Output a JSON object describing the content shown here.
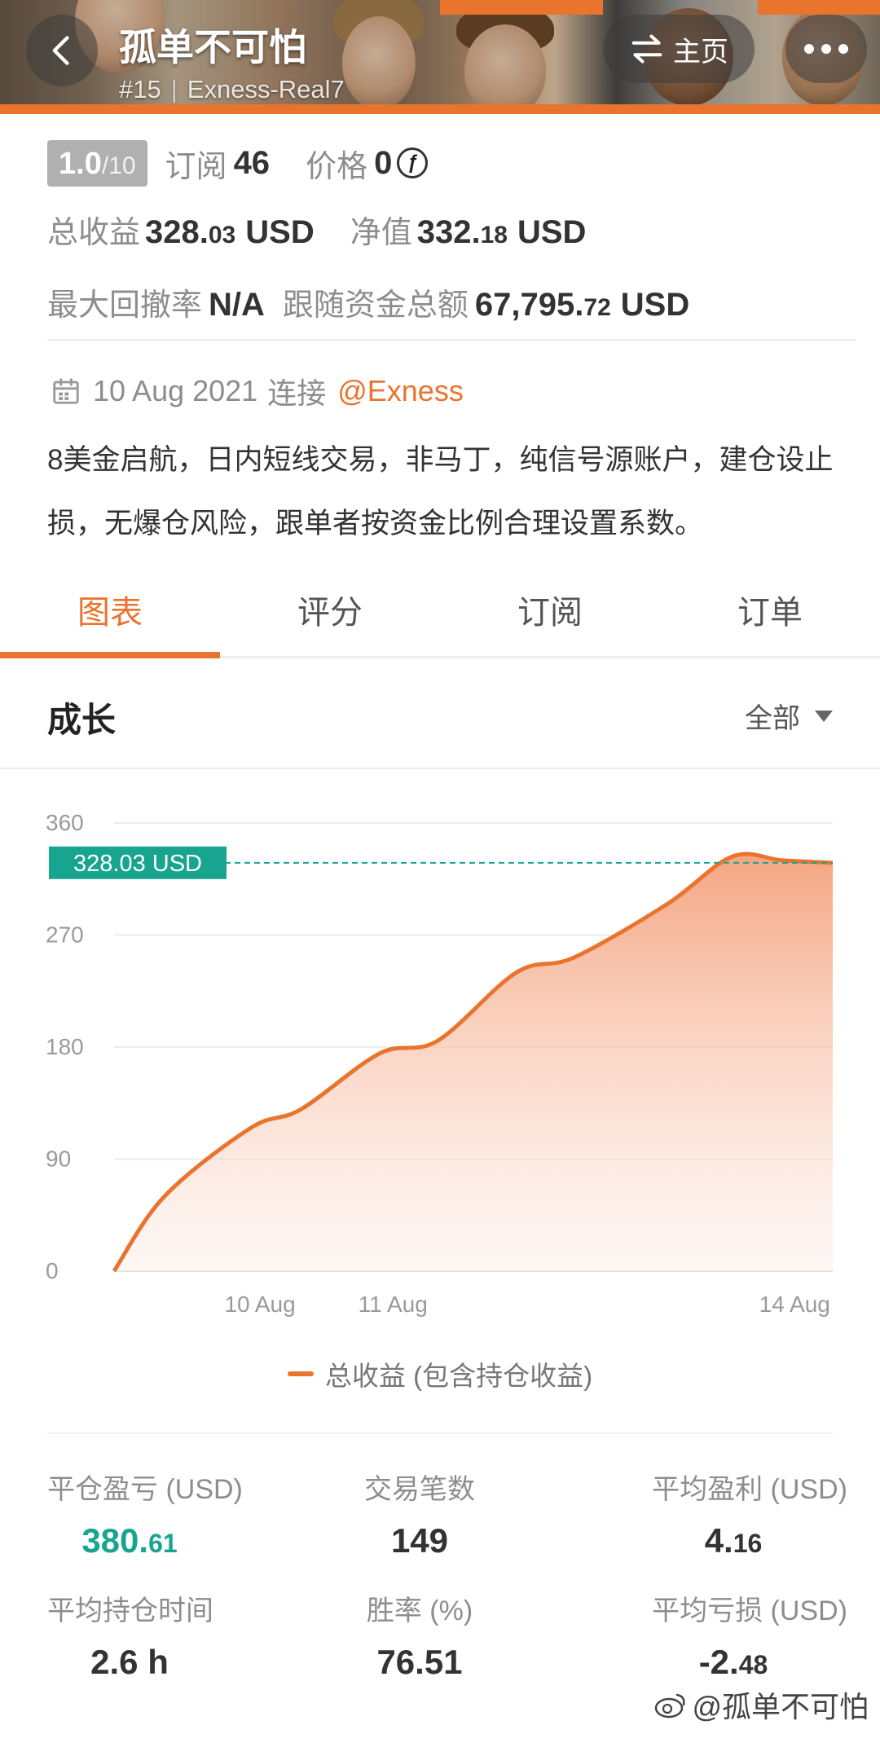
{
  "header": {
    "title": "孤单不可怕",
    "rank": "#15",
    "account": "Exness-Real7",
    "home_label": "主页",
    "back_icon": "chevron-left-icon",
    "more_icon": "more-dots-icon"
  },
  "stats": {
    "rating_value": "1.0",
    "rating_max": "/10",
    "subscribe_label": "订阅",
    "subscribe_value": "46",
    "price_label": "价格",
    "price_value": "0",
    "price_currency_symbol": "ƒ",
    "total_profit_label": "总收益",
    "total_profit_int": "328.",
    "total_profit_dec": "03",
    "total_profit_unit": "USD",
    "equity_label": "净值",
    "equity_int": "332.",
    "equity_dec": "18",
    "equity_unit": "USD",
    "max_drawdown_label": "最大回撤率",
    "max_drawdown_value": "N/A",
    "follow_funds_label": "跟随资金总额",
    "follow_funds_int": "67,795.",
    "follow_funds_dec": "72",
    "follow_funds_unit": "USD"
  },
  "connection": {
    "date": "10 Aug 2021",
    "connect_label": "连接",
    "broker": "@Exness"
  },
  "description": "8美金启航，日内短线交易，非马丁，纯信号源账户，建仓设止损，无爆仓风险，跟单者按资金比例合理设置系数。",
  "tabs": [
    {
      "label": "图表",
      "active": true
    },
    {
      "label": "评分",
      "active": false
    },
    {
      "label": "订阅",
      "active": false
    },
    {
      "label": "订单",
      "active": false
    }
  ],
  "growth": {
    "title": "成长",
    "range_label": "全部"
  },
  "chart_data": {
    "type": "area",
    "series": [
      {
        "name": "总收益 (包含持仓收益)",
        "x": [
          "09 Aug",
          "10 Aug",
          "10 Aug",
          "10 Aug",
          "11 Aug",
          "11 Aug",
          "12 Aug",
          "12 Aug",
          "13 Aug",
          "13 Aug",
          "14 Aug",
          "14 Aug"
        ],
        "values": [
          0,
          60,
          115,
          130,
          175,
          185,
          240,
          252,
          295,
          333,
          330,
          328.03
        ]
      }
    ],
    "x_tick_labels": [
      "10 Aug",
      "11 Aug",
      "14 Aug"
    ],
    "y_ticks": [
      "0",
      "90",
      "180",
      "270",
      "360"
    ],
    "ylim": [
      0,
      360
    ],
    "current_value": 328.03,
    "current_label": "328.03 USD",
    "color": "#e9742e",
    "marker_color": "#17a590",
    "grid": true,
    "legend_position": "bottom"
  },
  "summary": [
    {
      "label": "平仓盈亏 (USD)",
      "int": "380.",
      "dec": "61",
      "color": "teal"
    },
    {
      "label": "交易笔数",
      "int": "149",
      "dec": "",
      "color": "dark"
    },
    {
      "label": "平均盈利 (USD)",
      "int": "4.",
      "dec": "16",
      "color": "dark"
    },
    {
      "label": "平均持仓时间",
      "int": "2.6 h",
      "dec": "",
      "color": "dark"
    },
    {
      "label": "胜率 (%)",
      "int": "76.51",
      "dec": "",
      "color": "dark"
    },
    {
      "label": "平均亏损 (USD)",
      "int": "-2.",
      "dec": "48",
      "color": "dark"
    }
  ],
  "watermark": "@孤单不可怕"
}
